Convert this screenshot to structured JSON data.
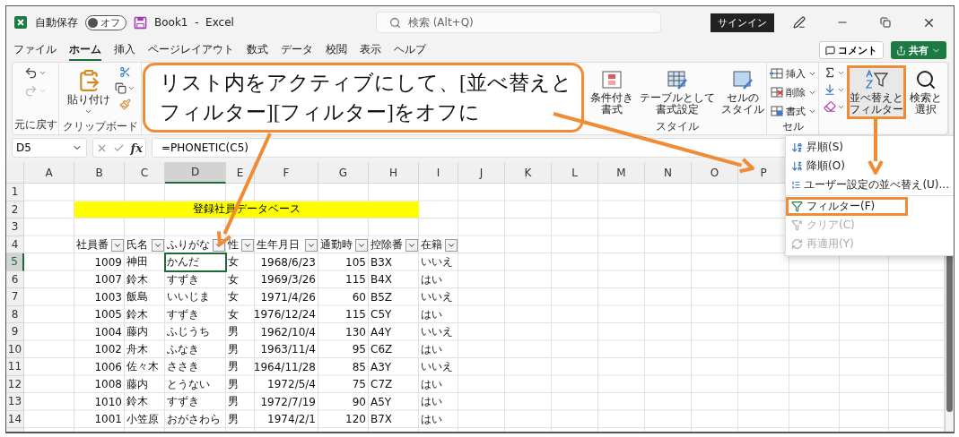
{
  "titlebar": {
    "autosave_label": "自動保存",
    "autosave": {
      "on": false,
      "label": "オフ"
    },
    "document": "Book1  -  Excel",
    "search_placeholder": "検索 (Alt+Q)",
    "signin": "サインイン"
  },
  "tabs": [
    {
      "label": "ファイル",
      "selected": false
    },
    {
      "label": "ホーム",
      "selected": true
    },
    {
      "label": "挿入",
      "selected": false
    },
    {
      "label": "ページレイアウト",
      "selected": false
    },
    {
      "label": "数式",
      "selected": false
    },
    {
      "label": "データ",
      "selected": false
    },
    {
      "label": "校閲",
      "selected": false
    },
    {
      "label": "表示",
      "selected": false
    },
    {
      "label": "ヘルプ",
      "selected": false
    }
  ],
  "actions": {
    "comment": "コメント",
    "share": "共有"
  },
  "ribbon": {
    "undo": {
      "label": "元に戻す",
      "redo_disabled": true
    },
    "clipboard": {
      "label": "クリップボード",
      "paste": "貼り付け"
    },
    "styles": {
      "label": "スタイル",
      "buttons": [
        {
          "kind": "conditional",
          "lines": [
            "条件付き",
            "書式"
          ]
        },
        {
          "kind": "table",
          "lines": [
            "テーブルとして",
            "書式設定"
          ]
        },
        {
          "kind": "cellstyle",
          "lines": [
            "セルの",
            "スタイル"
          ]
        }
      ]
    },
    "cells": {
      "label": "セル",
      "buttons": [
        {
          "kind": "insert",
          "label": "挿入"
        },
        {
          "kind": "delete",
          "label": "削除"
        },
        {
          "kind": "format",
          "label": "書式"
        }
      ]
    },
    "editing": {
      "sort_filter": {
        "lines": [
          "並べ替えと",
          "フィルター"
        ],
        "annotated": true
      },
      "find": {
        "lines": [
          "検索と",
          "選択"
        ]
      }
    }
  },
  "callout": {
    "lines": [
      "リスト内をアクティブにして、[並べ替えと",
      "フィルター][フィルター]をオフに"
    ]
  },
  "formula_bar": {
    "name_box": "D5",
    "fx": "fx",
    "formula": "=PHONETIC(C5)"
  },
  "sheet": {
    "columns": [
      {
        "letter": "A",
        "selected": false
      },
      {
        "letter": "B",
        "selected": false
      },
      {
        "letter": "C",
        "selected": false
      },
      {
        "letter": "D",
        "selected": true
      },
      {
        "letter": "E",
        "selected": false
      },
      {
        "letter": "F",
        "selected": false
      },
      {
        "letter": "G",
        "selected": false
      },
      {
        "letter": "H",
        "selected": false
      },
      {
        "letter": "I",
        "selected": false
      },
      {
        "letter": "J",
        "selected": false
      },
      {
        "letter": "K",
        "selected": false
      },
      {
        "letter": "L",
        "selected": false
      },
      {
        "letter": "M",
        "selected": false
      },
      {
        "letter": "N",
        "selected": false
      },
      {
        "letter": "O",
        "selected": false
      },
      {
        "letter": "P",
        "selected": false
      }
    ],
    "rows": [
      {
        "number": "1",
        "selected": false
      },
      {
        "number": "2",
        "selected": false
      },
      {
        "number": "3",
        "selected": false
      },
      {
        "number": "4",
        "selected": false
      },
      {
        "number": "5",
        "selected": true
      },
      {
        "number": "6",
        "selected": false
      },
      {
        "number": "7",
        "selected": false
      },
      {
        "number": "8",
        "selected": false
      },
      {
        "number": "9",
        "selected": false
      },
      {
        "number": "10",
        "selected": false
      },
      {
        "number": "11",
        "selected": false
      },
      {
        "number": "12",
        "selected": false
      },
      {
        "number": "13",
        "selected": false
      },
      {
        "number": "14",
        "selected": false
      }
    ],
    "title": "登録社員データベース",
    "headers": [
      {
        "label": "社員番",
        "numeric": true
      },
      {
        "label": "氏名",
        "numeric": false
      },
      {
        "label": "ふりがな",
        "numeric": false
      },
      {
        "label": "性",
        "numeric": false
      },
      {
        "label": "生年月日",
        "numeric": true
      },
      {
        "label": "通勤時",
        "numeric": true
      },
      {
        "label": "控除番",
        "numeric": false
      },
      {
        "label": "在籍",
        "numeric": false
      }
    ],
    "records": [
      [
        "1009",
        "神田",
        "かんだ",
        "女",
        "1968/6/23",
        "105",
        "B3X",
        "いいえ"
      ],
      [
        "1007",
        "鈴木",
        "すずき",
        "女",
        "1969/3/26",
        "115",
        "B4X",
        "はい"
      ],
      [
        "1003",
        "飯島",
        "いいじま",
        "女",
        "1971/4/26",
        "60",
        "B5Z",
        "いいえ"
      ],
      [
        "1005",
        "鈴木",
        "すずき",
        "女",
        "1976/12/24",
        "115",
        "C5Y",
        "はい"
      ],
      [
        "1004",
        "藤内",
        "ふじうち",
        "男",
        "1962/10/4",
        "130",
        "A4Y",
        "いいえ"
      ],
      [
        "1002",
        "舟木",
        "ふなき",
        "男",
        "1963/11/4",
        "95",
        "C6Z",
        "はい"
      ],
      [
        "1006",
        "佐々木",
        "ささき",
        "男",
        "1964/11/28",
        "85",
        "A3Y",
        "いいえ"
      ],
      [
        "1008",
        "藤内",
        "とうない",
        "男",
        "1972/5/4",
        "75",
        "C7Z",
        "はい"
      ],
      [
        "1010",
        "鈴木",
        "すずき",
        "男",
        "1972/7/19",
        "90",
        "A5Y",
        "はい"
      ],
      [
        "1001",
        "小笠原",
        "おがさわら",
        "男",
        "1974/2/1",
        "120",
        "B7X",
        "はい"
      ]
    ]
  },
  "menu": [
    {
      "kind": "sort-asc",
      "label": "昇順(S)",
      "disabled": false,
      "annotated": false
    },
    {
      "kind": "sort-desc",
      "label": "降順(O)",
      "disabled": false,
      "annotated": false
    },
    {
      "kind": "custom-sort",
      "label": "ユーザー設定の並べ替え(U)...",
      "disabled": false,
      "annotated": false
    },
    {
      "kind": "filter",
      "label": "フィルター(F)",
      "disabled": false,
      "annotated": true
    },
    {
      "kind": "clear",
      "label": "クリア(C)",
      "disabled": true,
      "annotated": false
    },
    {
      "kind": "reapply",
      "label": "再適用(Y)",
      "disabled": true,
      "annotated": false
    }
  ]
}
